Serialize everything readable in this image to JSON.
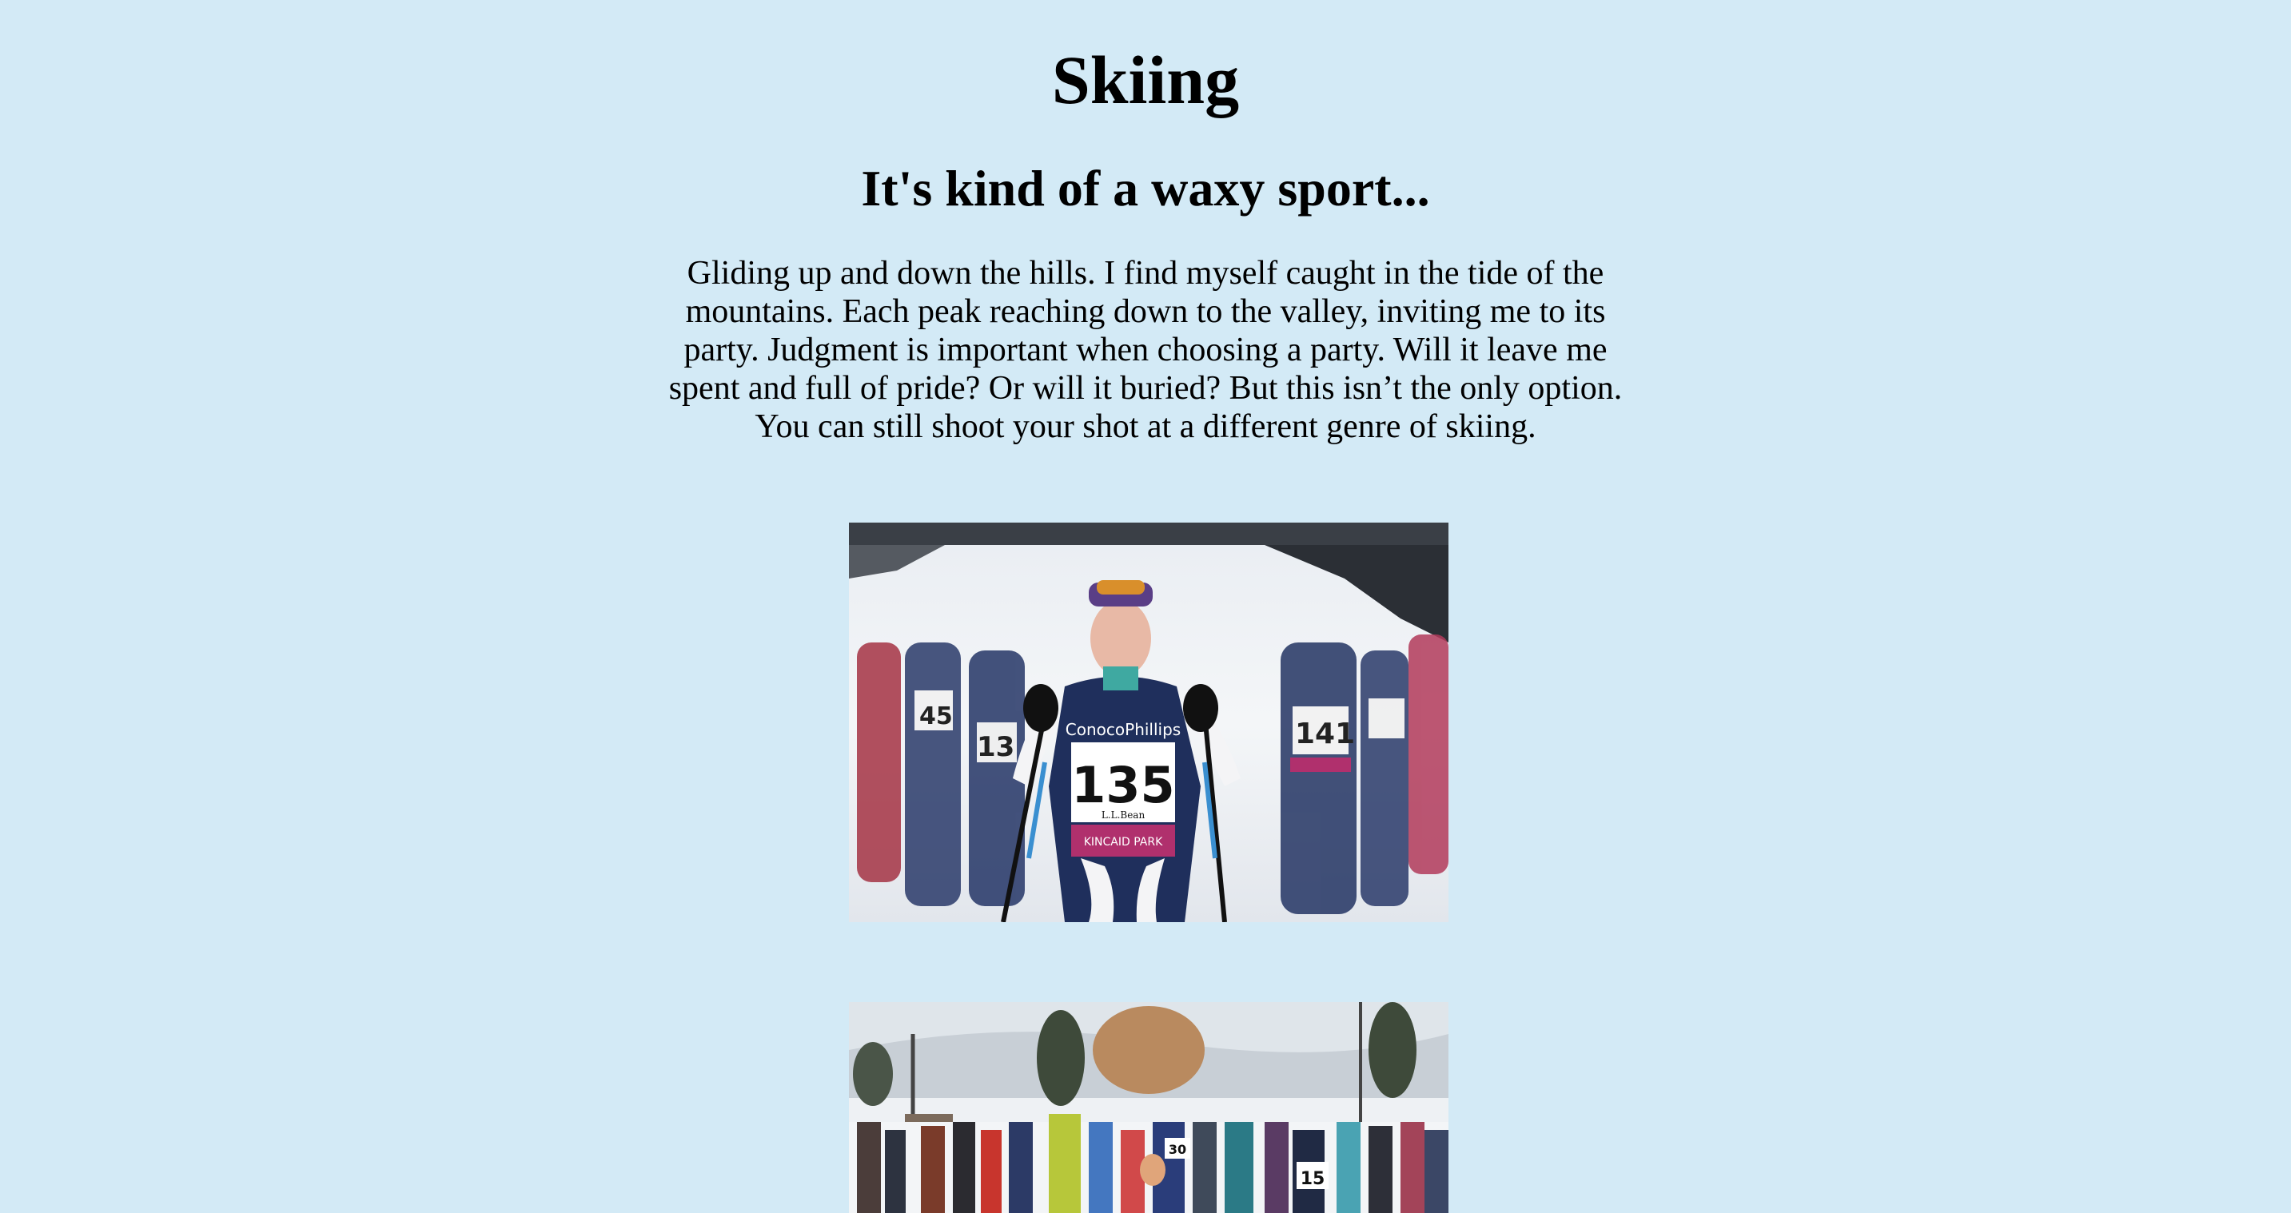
{
  "page": {
    "title": "Skiing",
    "subtitle": "It's kind of a waxy sport...",
    "paragraph": "Gliding up and down the hills. I find myself caught in the tide of the mountains. Each peak reaching down to the valley, inviting me to its party. Judgment is important when choosing a party. Will it leave me spent and full of pride? Or will it buried? But this isn’t the only option. You can still shoot your shot at a different genre of skiing."
  },
  "photo1": {
    "bib_main": "135",
    "bib_right": "141",
    "bib_left": "13",
    "bib_far_left": "45",
    "sponsor": "ConocoPhillips",
    "bib_sponsor": "L.L.Bean",
    "venue": "KINCAID PARK"
  },
  "photo2": {
    "bib_a": "15",
    "bib_b": "30"
  },
  "colors": {
    "background": "#d3eaf6",
    "suit_navy": "#1f2f5c",
    "suit_magenta": "#b0306d"
  }
}
